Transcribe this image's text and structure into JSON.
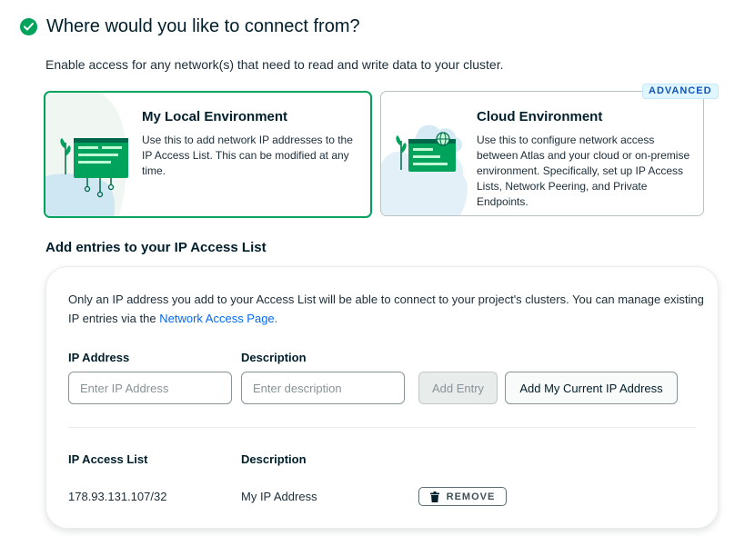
{
  "header": {
    "title": "Where would you like to connect from?"
  },
  "subtitle": "Enable access for any network(s) that need to read and write data to your cluster.",
  "cards": {
    "local": {
      "title": "My Local Environment",
      "description": "Use this to add network IP addresses to the IP Access List. This can be modified at any time.",
      "selected": true
    },
    "cloud": {
      "title": "Cloud Environment",
      "description": "Use this to configure network access between Atlas and your cloud or on-premise environment. Specifically, set up IP Access Lists, Network Peering, and Private Endpoints.",
      "badge": "ADVANCED"
    }
  },
  "access_list": {
    "section_title": "Add entries to your IP Access List",
    "info_text": "Only an IP address you add to your Access List will be able to connect to your project's clusters. You can manage existing IP entries via the",
    "info_link": "Network Access Page.",
    "ip_label": "IP Address",
    "description_label": "Description",
    "ip_placeholder": "Enter IP Address",
    "description_placeholder": "Enter description",
    "add_entry_label": "Add Entry",
    "add_current_ip_label": "Add My Current IP Address",
    "table": {
      "columns": [
        "IP Access List",
        "Description"
      ],
      "rows": [
        {
          "ip": "178.93.131.107/32",
          "description": "My IP Address",
          "action": "REMOVE"
        }
      ]
    }
  },
  "colors": {
    "accent": "#00a35c",
    "link": "#016bf8",
    "badge": "#1254b7"
  },
  "icons": [
    "check-circle-icon",
    "local-environment-illustration",
    "cloud-environment-illustration",
    "trash-icon"
  ]
}
